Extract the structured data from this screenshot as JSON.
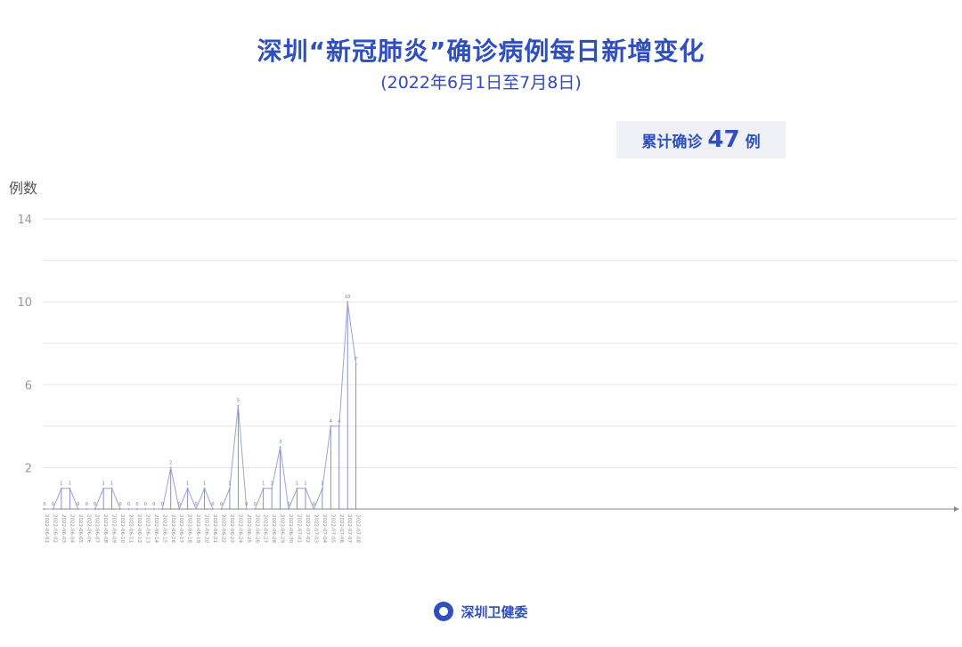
{
  "header": {
    "title": "深圳“新冠肺炎”确诊病例每日新增变化",
    "subtitle": "(2022年6月1日至7月8日)"
  },
  "total": {
    "label": "累计确诊",
    "value": "47",
    "unit": "例"
  },
  "footer": {
    "org": "深圳卫健委"
  },
  "colors": {
    "accent": "#2f4fbf",
    "line": "#9aa3d6",
    "grid": "#e6e6e6"
  },
  "chart_data": {
    "type": "line",
    "ylabel": "例数",
    "ylim": [
      0,
      14
    ],
    "yticks": [
      2,
      6,
      10,
      14
    ],
    "x": [
      "2022-06-01",
      "2022-06-02",
      "2022-06-03",
      "2022-06-04",
      "2022-06-05",
      "2022-06-06",
      "2022-06-07",
      "2022-06-08",
      "2022-06-09",
      "2022-06-10",
      "2022-06-11",
      "2022-06-12",
      "2022-06-13",
      "2022-06-14",
      "2022-06-15",
      "2022-06-16",
      "2022-06-17",
      "2022-06-18",
      "2022-06-19",
      "2022-06-20",
      "2022-06-21",
      "2022-06-22",
      "2022-06-23",
      "2022-06-24",
      "2022-06-25",
      "2022-06-26",
      "2022-06-27",
      "2022-06-28",
      "2022-06-29",
      "2022-06-30",
      "2022-07-01",
      "2022-07-02",
      "2022-07-03",
      "2022-07-04",
      "2022-07-05",
      "2022-07-06",
      "2022-07-07",
      "2022-07-08"
    ],
    "values": [
      0,
      0,
      1,
      1,
      0,
      0,
      0,
      1,
      1,
      0,
      0,
      0,
      0,
      0,
      0,
      2,
      0,
      1,
      0,
      1,
      0,
      0,
      1,
      5,
      0,
      0,
      1,
      1,
      3,
      0,
      1,
      1,
      0,
      1,
      4,
      4,
      10,
      7
    ]
  }
}
